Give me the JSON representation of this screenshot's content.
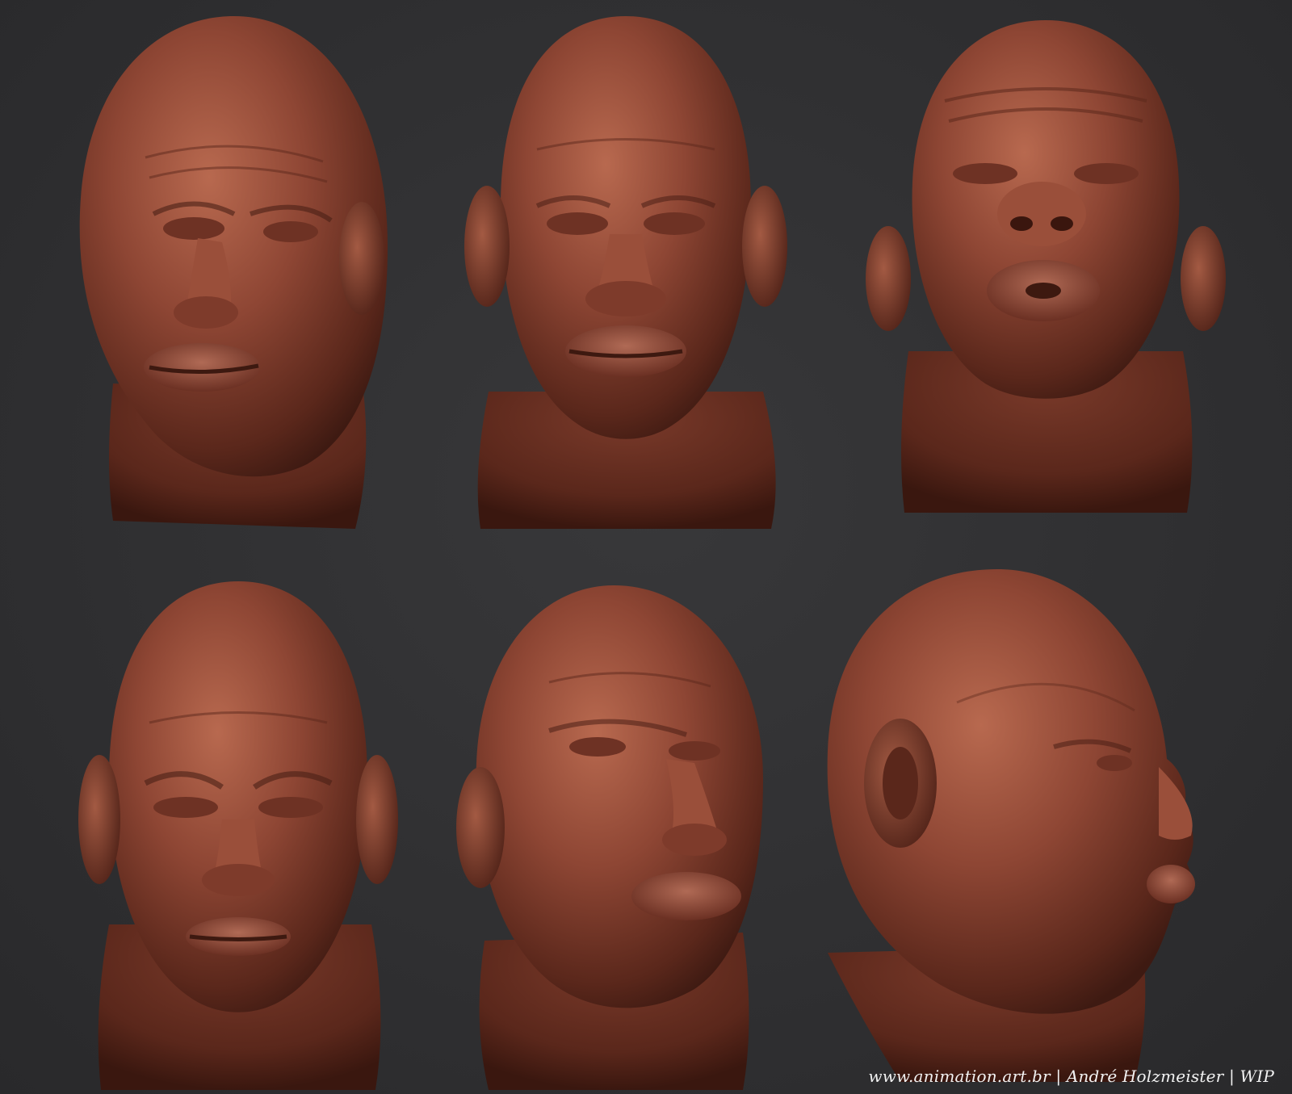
{
  "caption": "www.animation.art.br | André Holzmeister | WIP",
  "colors": {
    "background": "#2f2f31",
    "skin_light": "#b0624a",
    "skin_mid": "#8a4331",
    "skin_dark": "#4e2117",
    "caption_text": "#f2f2f2"
  },
  "renders": [
    {
      "view": "three-quarter-left-scowl"
    },
    {
      "view": "front-neutral"
    },
    {
      "view": "front-looking-up-pursed-lips"
    },
    {
      "view": "front-looking-down-frown"
    },
    {
      "view": "three-quarter-right-pursed-lips"
    },
    {
      "view": "right-profile"
    }
  ]
}
